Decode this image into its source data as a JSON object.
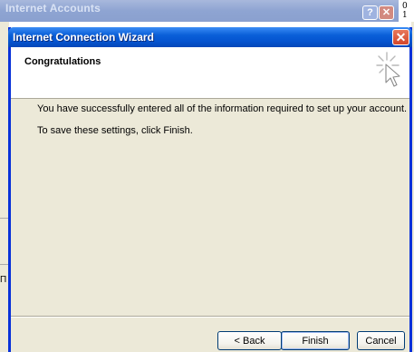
{
  "background_window": {
    "title": "Internet Accounts",
    "help_label": "?",
    "close_label": "✕",
    "edge_text": "0 1",
    "left_glyph": "Π"
  },
  "wizard": {
    "title": "Internet Connection Wizard",
    "close_label": "✕",
    "header_title": "Congratulations",
    "header_icon": "wizard-cursor-sparkle-icon",
    "message_1": "You have successfully entered all of the information required to set up your account.",
    "message_2": "To save these settings, click Finish.",
    "buttons": {
      "back": "< Back",
      "finish": "Finish",
      "cancel": "Cancel"
    }
  },
  "colors": {
    "titlebar_blue": "#0554d0",
    "window_face": "#ece9d8",
    "close_red": "#d2462a"
  }
}
